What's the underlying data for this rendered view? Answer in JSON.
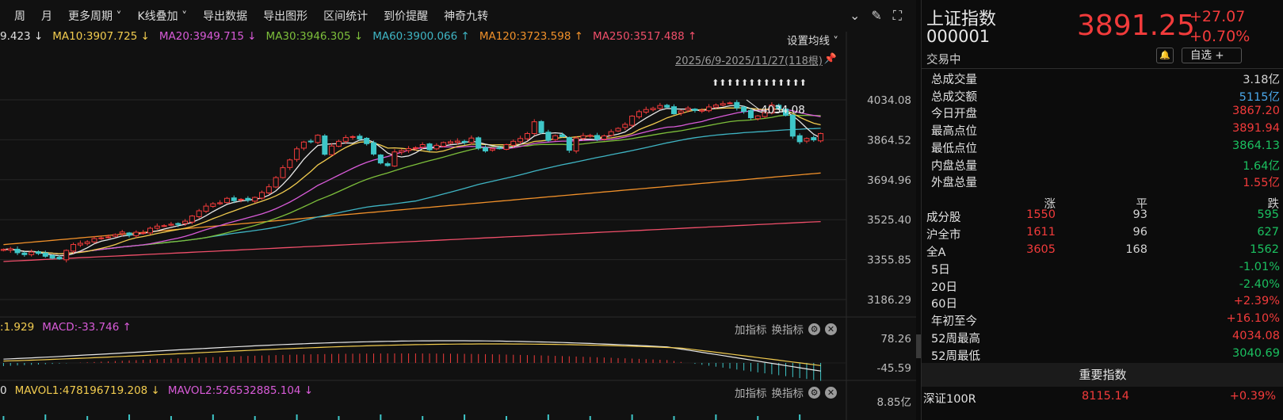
{
  "toolbar": {
    "items": [
      "周",
      "月",
      "更多周期 ˅",
      "K线叠加 ˅",
      "导出数据",
      "导出图形",
      "区间统计",
      "到价提醒",
      "神奇九转"
    ]
  },
  "ma_bar": [
    {
      "text": "9.423 ↓",
      "color": "#e0e0e0"
    },
    {
      "text": "MA10:3907.725 ↓",
      "color": "#f2cc4f"
    },
    {
      "text": "MA20:3949.715 ↓",
      "color": "#d85bd8"
    },
    {
      "text": "MA30:3946.305 ↓",
      "color": "#7dbf3b"
    },
    {
      "text": "MA60:3900.066 ↑",
      "color": "#3fb5c4"
    },
    {
      "text": "MA120:3723.598 ↑",
      "color": "#f0902a"
    },
    {
      "text": "MA250:3517.488 ↑",
      "color": "#f04f6a"
    }
  ],
  "setup_ma_label": "设置均线 ˅",
  "range_label": "2025/6/9-2025/11/27(118根)",
  "price_axis": [
    "4034.08",
    "3864.52",
    "3694.96",
    "3525.40",
    "3355.85",
    "3186.29"
  ],
  "peak_label": "4034.08",
  "nine_signal": "⬆⬆⬆⬆⬆⬆⬆⬆⬆⬆⬆⬆⬆",
  "macd": {
    "labels": [
      {
        "text": ":1.929",
        "color": "#f2cc4f"
      },
      {
        "text": "MACD:-33.746 ↑",
        "color": "#d85bd8"
      }
    ],
    "axis": [
      "78.26",
      "-45.59"
    ]
  },
  "vol": {
    "labels": [
      {
        "text": "0",
        "color": "#e0e0e0"
      },
      {
        "text": "MAVOL1:478196719.208 ↓",
        "color": "#f2cc4f"
      },
      {
        "text": "MAVOL2:526532885.104 ↓",
        "color": "#d85bd8"
      }
    ],
    "axis": [
      "8.85亿"
    ]
  },
  "indicator_controls": {
    "add": "加指标",
    "swap": "换指标"
  },
  "quote": {
    "name": "上证指数",
    "code": "000001",
    "price": "3891.25",
    "change": "+27.07",
    "change_pct": "+0.70%",
    "status": "交易中",
    "fav_label": "自选 +",
    "stats": [
      {
        "k": "总成交量",
        "v": "3.18亿",
        "c": "flat"
      },
      {
        "k": "总成交额",
        "v": "5115亿",
        "c": "blue"
      },
      {
        "k": "今日开盘",
        "v": "3867.20",
        "c": "up"
      },
      {
        "k": "最高点位",
        "v": "3891.94",
        "c": "up"
      },
      {
        "k": "最低点位",
        "v": "3864.13",
        "c": "down"
      },
      {
        "k": "内盘总量",
        "v": "1.64亿",
        "c": "down"
      },
      {
        "k": "外盘总量",
        "v": "1.55亿",
        "c": "up"
      }
    ],
    "breadth_head": [
      "涨",
      "平",
      "跌"
    ],
    "breadth": [
      {
        "k": "成分股",
        "up": "1550",
        "flat": "93",
        "down": "595"
      },
      {
        "k": "沪全市",
        "up": "1611",
        "flat": "96",
        "down": "627"
      },
      {
        "k": "全A",
        "up": "3605",
        "flat": "168",
        "down": "1562"
      }
    ],
    "perf": [
      {
        "k": "5日",
        "v": "-1.01%",
        "c": "down"
      },
      {
        "k": "20日",
        "v": "-2.40%",
        "c": "down"
      },
      {
        "k": "60日",
        "v": "+2.39%",
        "c": "up"
      },
      {
        "k": "年初至今",
        "v": "+16.10%",
        "c": "up"
      },
      {
        "k": "52周最高",
        "v": "4034.08",
        "c": "up"
      },
      {
        "k": "52周最低",
        "v": "3040.69",
        "c": "down"
      }
    ],
    "index_head": "重要指数",
    "index_row": {
      "name": "深证100R",
      "price": "8115.14",
      "change": "+0.39%"
    }
  },
  "chart_data": {
    "type": "candlestick",
    "x": [
      "2025/6/9",
      "2025/11/27"
    ],
    "bars": 118,
    "ylim": [
      3186.29,
      4034.08
    ],
    "close": [
      3399,
      3402,
      3385,
      3377,
      3388,
      3382,
      3370,
      3362,
      3359,
      3395,
      3420,
      3425,
      3431,
      3445,
      3448,
      3452,
      3462,
      3473,
      3460,
      3472,
      3470,
      3489,
      3498,
      3500,
      3506,
      3505,
      3519,
      3541,
      3563,
      3583,
      3593,
      3597,
      3616,
      3606,
      3612,
      3608,
      3620,
      3641,
      3665,
      3704,
      3746,
      3779,
      3826,
      3855,
      3857,
      3884,
      3803,
      3838,
      3858,
      3874,
      3878,
      3868,
      3848,
      3804,
      3766,
      3755,
      3813,
      3819,
      3827,
      3831,
      3844,
      3822,
      3841,
      3853,
      3856,
      3859,
      3853,
      3872,
      3829,
      3817,
      3826,
      3828,
      3844,
      3858,
      3870,
      3891,
      3941,
      3895,
      3862,
      3882,
      3878,
      3820,
      3872,
      3882,
      3883,
      3866,
      3881,
      3899,
      3913,
      3930,
      3965,
      3984,
      3993,
      3998,
      4010,
      4003,
      3975,
      3987,
      3999,
      3989,
      3990,
      4004,
      4012,
      4018,
      4021,
      4000,
      3985,
      3958,
      3966,
      3980,
      4012,
      3995,
      3968,
      3880,
      3856,
      3870,
      3864,
      3891
    ],
    "series": [
      {
        "name": "MA10",
        "last": 3907.725
      },
      {
        "name": "MA20",
        "last": 3949.715
      },
      {
        "name": "MA30",
        "last": 3946.305
      },
      {
        "name": "MA60",
        "last": 3900.066
      },
      {
        "name": "MA120",
        "last": 3723.598
      },
      {
        "name": "MA250",
        "last": 3517.488
      }
    ],
    "colors": {
      "up": "#f23b3b",
      "down": "#3ec6c8",
      "ma10": "#f2cc4f",
      "ma20": "#d85bd8",
      "ma30": "#7dbf3b",
      "ma60": "#3fb5c4",
      "ma120": "#f0902a",
      "ma250": "#f04f6a"
    }
  }
}
